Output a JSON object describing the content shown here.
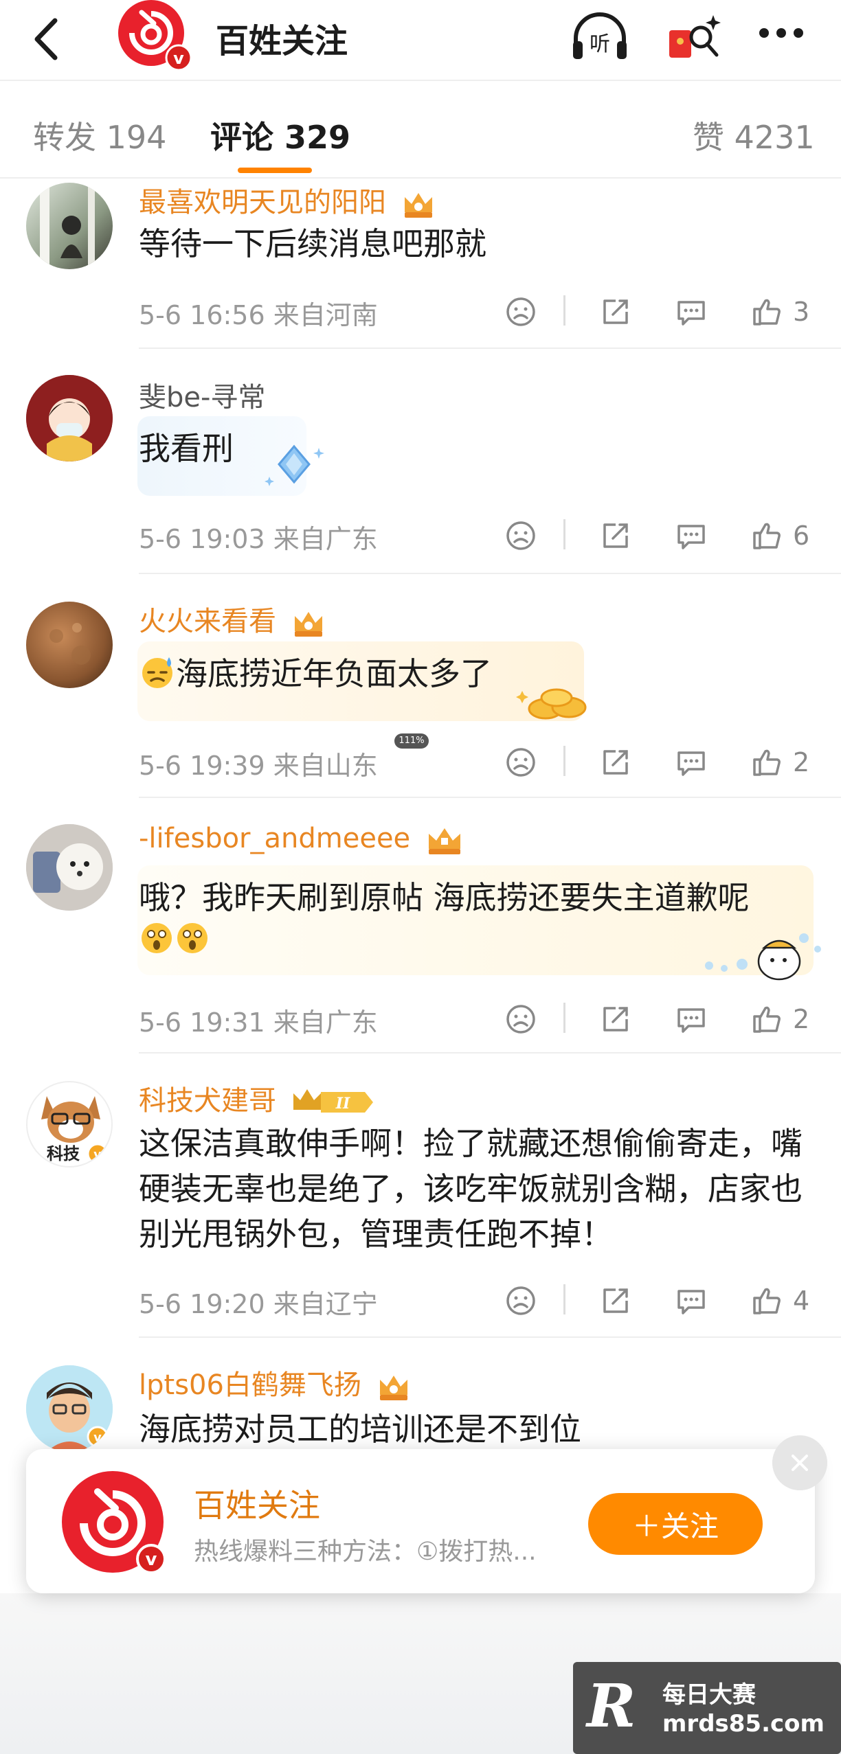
{
  "header": {
    "account_name": "百姓关注",
    "icons": [
      "back-chevron-icon",
      "listen-icon",
      "red-packet-icon",
      "more-icon"
    ],
    "listen_label": "听"
  },
  "tabs": [
    {
      "label": "转发 194"
    },
    {
      "label": "评论 329"
    },
    {
      "label": "赞 4231"
    }
  ],
  "comments": [
    {
      "user": "最喜欢明天见的阳阳",
      "text": "等待一下后续消息吧那就",
      "time": "5-6 16:56",
      "location": "来自河南",
      "likes": "3"
    },
    {
      "user": "斐be-寻常",
      "text": "我看刑",
      "time": "5-6 19:03",
      "location": "来自广东",
      "likes": "6"
    },
    {
      "user": "火火来看看",
      "text": "海底捞近年负面太多了",
      "time": "5-6 19:39",
      "location": "来自山东",
      "likes": "2",
      "bubble_tag": "111%"
    },
    {
      "user": "-lifesbor_andmeeee",
      "text": "哦？我昨天刷到原帖 海底捞还要失主道歉呢",
      "time": "5-6 19:31",
      "location": "来自广东",
      "likes": "2"
    },
    {
      "user": "科技犬建哥",
      "text": "这保洁真敢伸手啊！捡了就藏还想偷偷寄走，嘴硬装无辜也是绝了，该吃牢饭就别含糊，店家也别光甩锅外包，管理责任跑不掉！",
      "time": "5-6 19:20",
      "location": "来自辽宁",
      "likes": "4",
      "avatar_label": "科技"
    },
    {
      "user": "lpts06白鹤舞飞扬",
      "text": "海底捞对员工的培训还是不到位"
    }
  ],
  "popup": {
    "name": "百姓关注",
    "desc": "热线爆料三种方法：①拨打热...",
    "follow_label": "＋关注"
  },
  "watermark": {
    "logo": "R",
    "title": "每日大赛",
    "url": "mrds85.com"
  },
  "colors": {
    "accent": "#ff8200",
    "vip_name": "#e88622",
    "follow_button": "#ff8a00"
  }
}
